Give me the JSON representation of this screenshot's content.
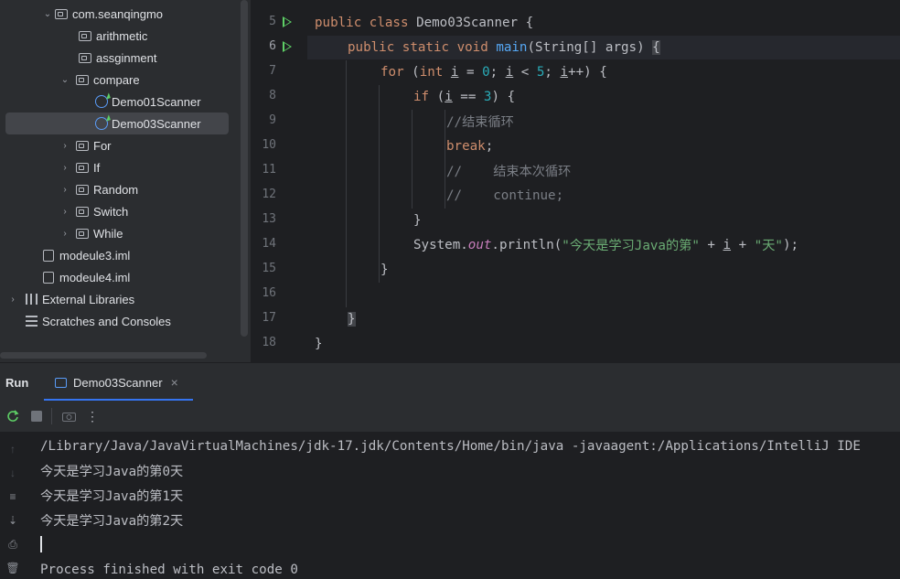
{
  "project_tree": {
    "items": [
      {
        "label": "com.seanqingmo",
        "type": "package",
        "expanded": true
      },
      {
        "label": "arithmetic",
        "type": "package"
      },
      {
        "label": "assginment",
        "type": "package"
      },
      {
        "label": "compare",
        "type": "package",
        "expanded": true
      },
      {
        "label": "Demo01Scanner",
        "type": "class"
      },
      {
        "label": "Demo03Scanner",
        "type": "class",
        "selected": true
      },
      {
        "label": "For",
        "type": "package"
      },
      {
        "label": "If",
        "type": "package"
      },
      {
        "label": "Random",
        "type": "package"
      },
      {
        "label": "Switch",
        "type": "package"
      },
      {
        "label": "While",
        "type": "package"
      },
      {
        "label": "modeule3.iml",
        "type": "file"
      },
      {
        "label": "modeule4.iml",
        "type": "file"
      },
      {
        "label": "External Libraries",
        "type": "libraries"
      },
      {
        "label": "Scratches and Consoles",
        "type": "scratches"
      }
    ]
  },
  "editor": {
    "line_numbers": [
      "5",
      "6",
      "7",
      "8",
      "9",
      "10",
      "11",
      "12",
      "13",
      "14",
      "15",
      "16",
      "17",
      "18"
    ],
    "current_line": "6",
    "lines": {
      "l5": {
        "kw1": "public",
        "kw2": "class",
        "rest": "Demo03Scanner {"
      },
      "l6": {
        "kw1": "public",
        "kw2": "static",
        "kw3": "void",
        "fn": "main",
        "rest": "(String[] args) ",
        "brace": "{"
      },
      "l7": {
        "kw": "for",
        "p1": " (",
        "kw2": "int",
        "sp": " ",
        "v1": "i",
        "p2": " = ",
        "n1": "0",
        "p3": "; ",
        "v2": "i",
        "p4": " < ",
        "n2": "5",
        "p5": "; ",
        "v3": "i",
        "p6": "++) {"
      },
      "l8": {
        "kw": "if",
        "p1": " (",
        "v1": "i",
        "p2": " == ",
        "n1": "3",
        "p3": ") {"
      },
      "l9": {
        "cmt": "//结束循环"
      },
      "l10": {
        "kw": "break",
        "p": ";"
      },
      "l11": {
        "cmt": "//    结束本次循环"
      },
      "l12": {
        "cmt": "//    continue;"
      },
      "l13": {
        "p": "}"
      },
      "l14": {
        "p1": "System.",
        "stat": "out",
        "p2": ".println(",
        "s1": "\"今天是学习Java的第\"",
        "p3": " + ",
        "v": "i",
        "p4": " + ",
        "s2": "\"天\"",
        "p5": ");"
      },
      "l15": {
        "p": "}"
      },
      "l17": {
        "p": "}"
      },
      "l18": {
        "p": "}"
      }
    }
  },
  "run_panel": {
    "title": "Run",
    "tab_label": "Demo03Scanner",
    "tab_close": "×",
    "console_lines": [
      "/Library/Java/JavaVirtualMachines/jdk-17.jdk/Contents/Home/bin/java -javaagent:/Applications/IntelliJ IDE",
      "今天是学习Java的第0天",
      "今天是学习Java的第1天",
      "今天是学习Java的第2天",
      "",
      "Process finished with exit code 0"
    ]
  },
  "colors": {
    "accent": "#3574f0",
    "keyword": "#cf8e6d",
    "function": "#56a8f5",
    "number": "#2aacb8",
    "string": "#6aab73",
    "comment": "#7a7e85",
    "run_green": "#5ed066"
  }
}
